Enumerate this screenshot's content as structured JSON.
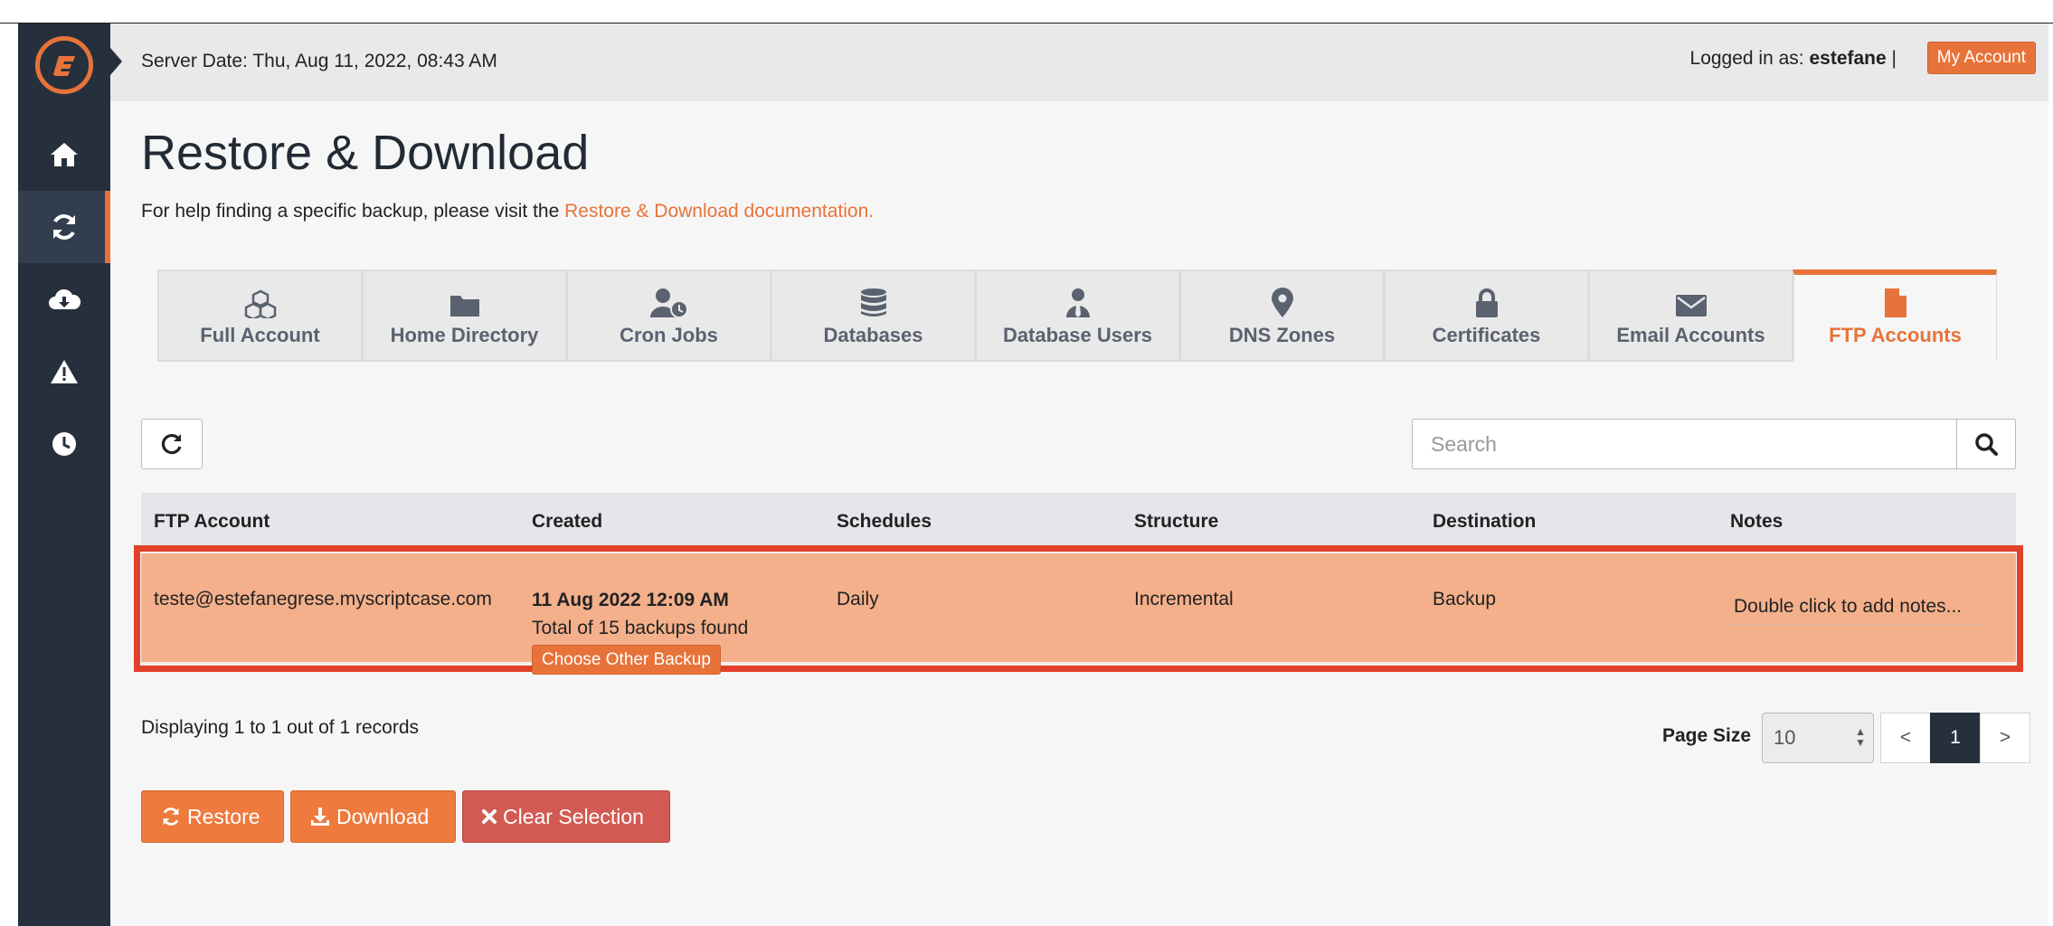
{
  "topbar": {
    "server_date": "Server Date: Thu, Aug 11, 2022, 08:43 AM",
    "logged_in_prefix": "Logged in as:",
    "username": "estefane",
    "separator": "|",
    "my_account": "My Account"
  },
  "sidebar": {
    "items": [
      {
        "icon": "home-icon"
      },
      {
        "icon": "refresh-icon",
        "active": true
      },
      {
        "icon": "cloud-download-icon"
      },
      {
        "icon": "warning-icon"
      },
      {
        "icon": "clock-icon"
      }
    ]
  },
  "page": {
    "title": "Restore & Download",
    "help_text": "For help finding a specific backup, please visit the ",
    "help_link": "Restore & Download documentation."
  },
  "tabs": [
    {
      "label": "Full Account",
      "icon": "cubes-icon"
    },
    {
      "label": "Home Directory",
      "icon": "folder-icon"
    },
    {
      "label": "Cron Jobs",
      "icon": "user-clock-icon"
    },
    {
      "label": "Databases",
      "icon": "database-icon"
    },
    {
      "label": "Database Users",
      "icon": "user-tie-icon"
    },
    {
      "label": "DNS Zones",
      "icon": "map-marker-icon"
    },
    {
      "label": "Certificates",
      "icon": "lock-icon"
    },
    {
      "label": "Email Accounts",
      "icon": "envelope-icon"
    },
    {
      "label": "FTP Accounts",
      "icon": "file-icon",
      "active": true
    }
  ],
  "search": {
    "placeholder": "Search",
    "value": ""
  },
  "table": {
    "headers": [
      "FTP Account",
      "Created",
      "Schedules",
      "Structure",
      "Destination",
      "Notes"
    ],
    "rows": [
      {
        "account": "teste@estefanegrese.myscriptcase.com",
        "created_date": "11 Aug 2022 12:09 AM",
        "created_total": "Total of 15 backups found",
        "choose_label": "Choose Other Backup",
        "schedules": "Daily",
        "structure": "Incremental",
        "destination": "Backup",
        "notes": "Double click to add notes..."
      }
    ]
  },
  "footer": {
    "displaying": "Displaying 1 to 1 out of 1 records",
    "page_size_label": "Page Size",
    "page_size_value": "10",
    "pager": {
      "prev": "<",
      "current": "1",
      "next": ">"
    }
  },
  "actions": {
    "restore": "Restore",
    "download": "Download",
    "clear": "Clear Selection"
  },
  "colors": {
    "accent": "#e8733a",
    "sidebar": "#26303d",
    "selected_row": "#f3b08b",
    "highlight_border": "#e2402a",
    "danger": "#d25a52"
  }
}
